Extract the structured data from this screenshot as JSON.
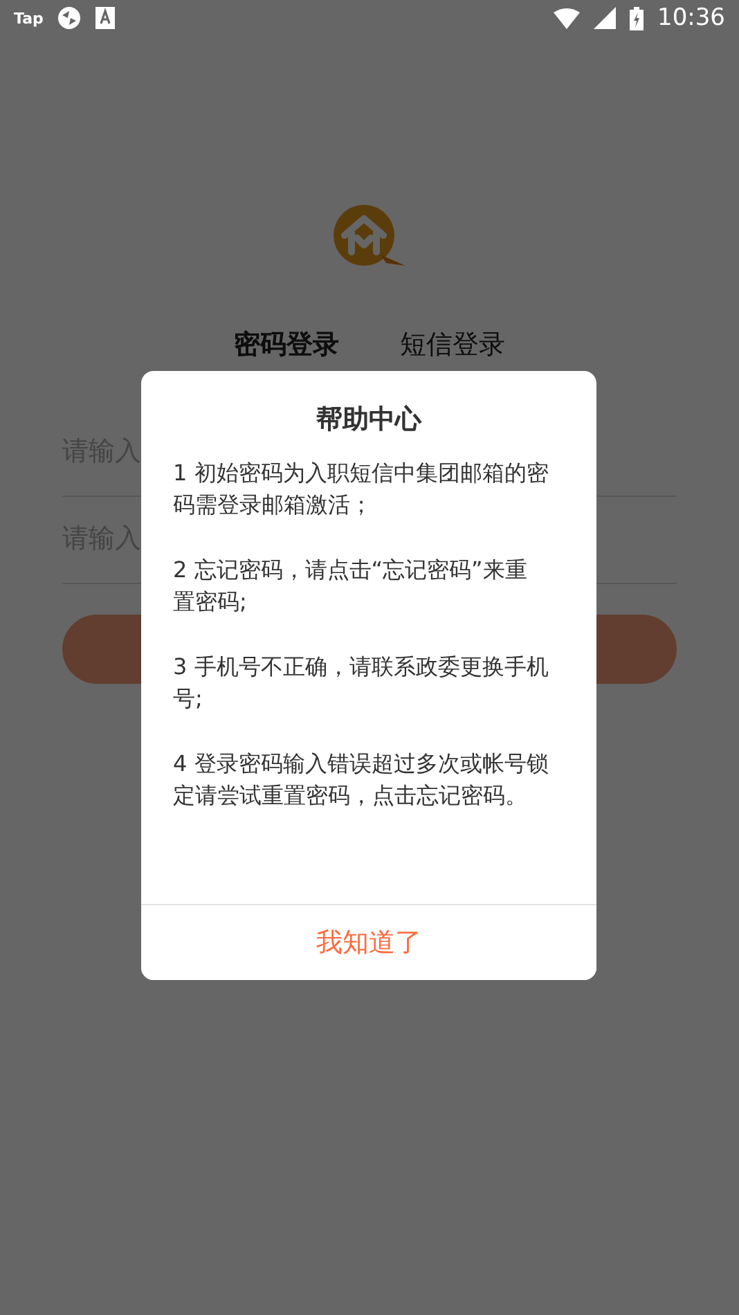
{
  "status_bar": {
    "app_label": "Tap",
    "time": "10:36"
  },
  "login": {
    "tabs": [
      {
        "label": "密码登录",
        "selected": true
      },
      {
        "label": "短信登录",
        "selected": false
      }
    ],
    "fields": [
      {
        "placeholder": "请输入"
      },
      {
        "placeholder": "请输入"
      }
    ]
  },
  "dialog": {
    "title": "帮助中心",
    "paragraphs": [
      "1 初始密码为入职短信中集团邮箱的密码需登录邮箱激活；",
      "2 忘记密码，请点击“忘记密码”来重置密码;",
      "3 手机号不正确，请联系政委更换手机号;",
      "4 登录密码输入错误超过多次或帐号锁定请尝试重置密码，点击忘记密码。"
    ],
    "button": "我知道了"
  }
}
